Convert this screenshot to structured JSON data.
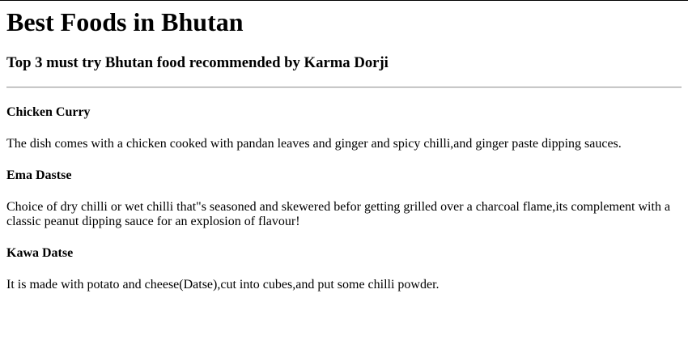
{
  "title": "Best Foods in Bhutan",
  "subtitle": "Top 3 must try Bhutan food recommended by Karma Dorji",
  "foods": [
    {
      "name": "Chicken Curry",
      "description": "The dish comes with a chicken cooked with pandan leaves and ginger and spicy chilli,and ginger paste dipping sauces."
    },
    {
      "name": "Ema Dastse",
      "description": "Choice of dry chilli or wet chilli that\"s seasoned and skewered befor getting grilled over a charcoal flame,its complement with a classic peanut dipping sauce for an explosion of flavour!"
    },
    {
      "name": "Kawa Datse",
      "description": "It is made with potato and cheese(Datse),cut into cubes,and put some chilli powder."
    }
  ]
}
